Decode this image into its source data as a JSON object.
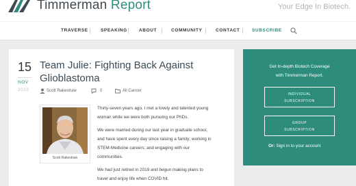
{
  "header": {
    "logo_main": "Timmerman",
    "logo_accent": "Report",
    "tagline": "Your Edge In Biotech."
  },
  "nav": {
    "items": [
      "TRAVERSE",
      "SPEAKING",
      "ABOUT",
      "COMMUNITY",
      "CONTACT",
      "SUBSCRIBE"
    ],
    "search_icon": "search-icon"
  },
  "post": {
    "date": {
      "day": "15",
      "month": "NOV",
      "year": "2022"
    },
    "title_line1": "Team Julie: Fighting Back Against",
    "title_line2": "Glioblastoma",
    "author": "Scott Rakestraw",
    "comments": "0",
    "category": "All Cancer",
    "photo_caption": "Scott Rakestraw",
    "paragraphs": [
      [
        "Thirty-seven years ago, I met a lovely and talented young",
        "woman while we were both pursuing our PhDs."
      ],
      [
        "We were married during our last year in graduate school,",
        "and have spent every day since raising a family; working in",
        "STEM-Medicine careers; and engaging with our",
        "communities."
      ],
      [
        "We had just retired in 2019 and begun making plans to",
        "travel and enjoy life when COVID hit."
      ]
    ]
  },
  "sidebar": {
    "heading_line1": "Get In-depth Biotech Coverage",
    "heading_line2": "with Timmerman Report.",
    "button1_line1": "INDIVIDUAL",
    "button1_line2": "SUBSCRIPTION",
    "button2_line1": "GROUP",
    "button2_line2": "SUBSCRIPTION",
    "signin_or": "Or:",
    "signin_text": "Sign in to your account"
  },
  "colors": {
    "accent": "#2e8c7d",
    "text_dark": "#3b4a55"
  }
}
